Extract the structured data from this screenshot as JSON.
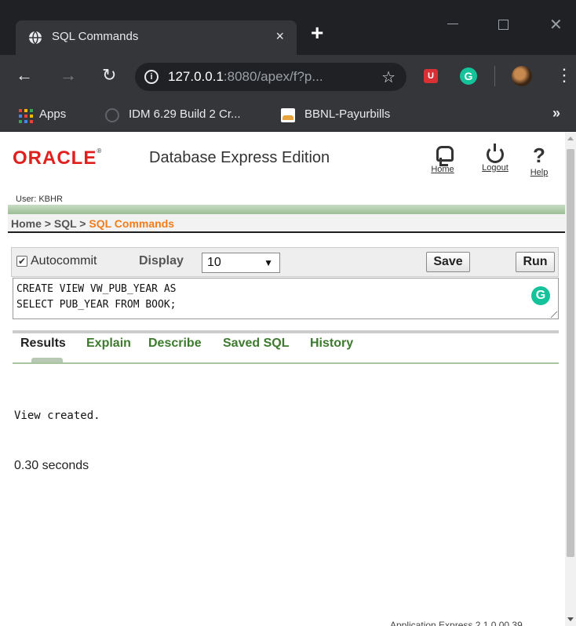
{
  "browser": {
    "tab_title": "SQL Commands",
    "tab_close": "×",
    "new_tab": "+",
    "url_host": "127.0.0.1",
    "url_rest": ":8080/apex/f?p...",
    "bookmarks": [
      {
        "label": "Apps"
      },
      {
        "label": "IDM 6.29 Build 2 Cr..."
      },
      {
        "label": "BBNL-Payurbills"
      }
    ],
    "bookmarks_more": "»"
  },
  "header": {
    "logo_text": "ORACLE",
    "logo_mark": "®",
    "product": "Database Express Edition",
    "links": {
      "home": "Home",
      "logout": "Logout",
      "help": "Help"
    },
    "help_glyph": "?",
    "user": "User: KBHR"
  },
  "breadcrumb": {
    "items": [
      "Home",
      "SQL"
    ],
    "separator": " > ",
    "current": "SQL Commands"
  },
  "commands": {
    "autocommit_label": "Autocommit",
    "autocommit_checked": true,
    "display_label": "Display",
    "display_value": "10",
    "save_label": "Save",
    "run_label": "Run",
    "sql_text": "CREATE VIEW VW_PUB_YEAR AS\nSELECT PUB_YEAR FROM BOOK;"
  },
  "result_tabs": [
    {
      "label": "Results",
      "active": true
    },
    {
      "label": "Explain",
      "active": false
    },
    {
      "label": "Describe",
      "active": false
    },
    {
      "label": "Saved SQL",
      "active": false
    },
    {
      "label": "History",
      "active": false
    }
  ],
  "results": {
    "message": "View created.",
    "elapsed": "0.30 seconds"
  },
  "footer": {
    "version": "Application Express 2.1.0.00.39"
  },
  "colors": {
    "oracle_red": "#e0201e",
    "breadcrumb_current": "#f07c1c",
    "tab_green": "#3d7a2e",
    "grammarly_green": "#15c39a"
  }
}
